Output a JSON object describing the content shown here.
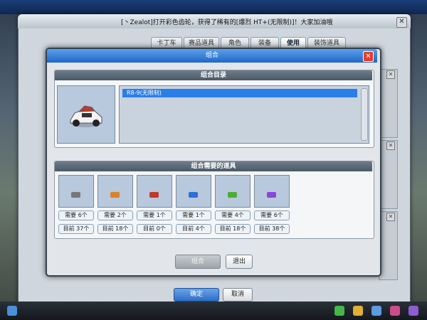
{
  "notice": {
    "message": "[丶Zealot]打开彩色齿轮，获得了稀有的[爆烈 HT+(无限制)]！大家加油哦"
  },
  "outer_window": {
    "tabs": [
      "卡丁车",
      "赛品道具",
      "角色",
      "装备",
      "使用",
      "装饰道具"
    ],
    "active_tab": "使用",
    "confirm_label": "确定",
    "cancel_label": "取消",
    "close_icon": "x-icon"
  },
  "dialog": {
    "title": "组合",
    "close_icon": "x-icon",
    "catalog_header": "组合目录",
    "catalog_items": [
      "R8-9(无限制)"
    ],
    "selected_item": "R8-9(无限制)",
    "requirements_header": "组合需要的道具",
    "requirements": [
      {
        "need": "需要 6个",
        "have": "目前 37个",
        "color": "#777777"
      },
      {
        "need": "需要 2个",
        "have": "目前 18个",
        "color": "#d9822b"
      },
      {
        "need": "需要 1个",
        "have": "目前 0个",
        "color": "#c0392b"
      },
      {
        "need": "需要 1个",
        "have": "目前 4个",
        "color": "#2e6fd8"
      },
      {
        "need": "需要 4个",
        "have": "目前 18个",
        "color": "#4caf32"
      },
      {
        "need": "需要 6个",
        "have": "目前 38个",
        "color": "#8e44d8"
      }
    ],
    "combine_label": "组合",
    "exit_label": "退出"
  }
}
